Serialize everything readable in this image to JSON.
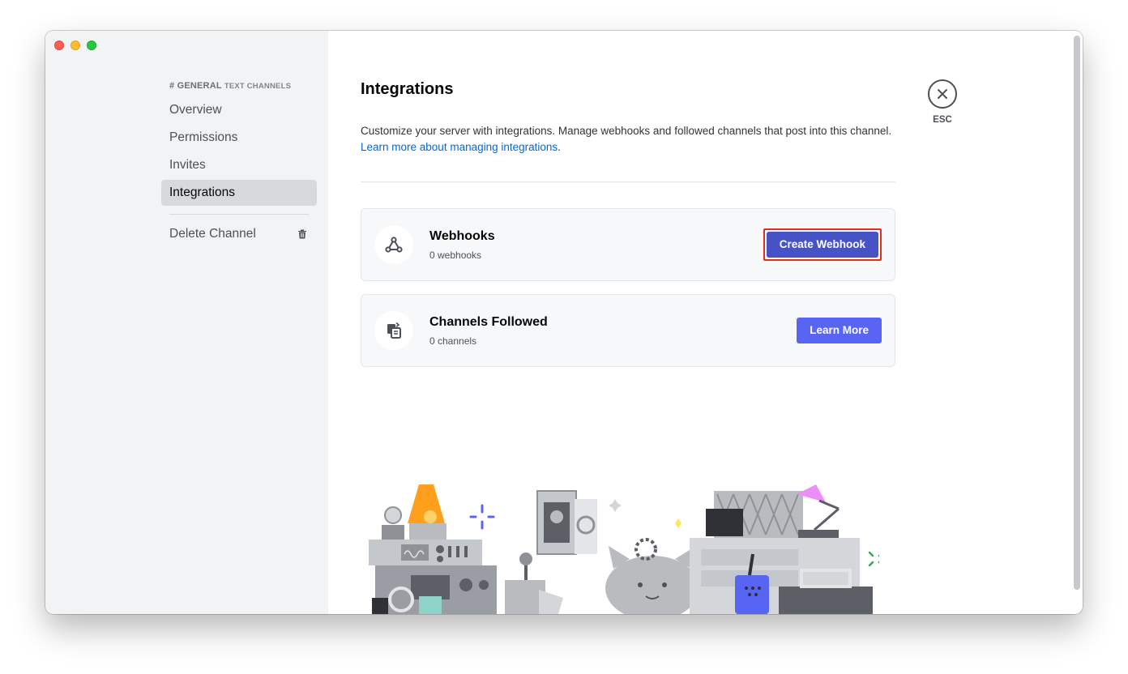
{
  "sidebar": {
    "channel_name": "# general",
    "section_label": "text channels",
    "items": [
      {
        "label": "Overview"
      },
      {
        "label": "Permissions"
      },
      {
        "label": "Invites"
      },
      {
        "label": "Integrations"
      }
    ],
    "delete_label": "Delete Channel"
  },
  "main": {
    "title": "Integrations",
    "description": "Customize your server with integrations. Manage webhooks and followed channels that post into this channel.",
    "learn_link": "Learn more about managing integrations",
    "learn_suffix": ".",
    "cards": [
      {
        "title": "Webhooks",
        "subtitle": "0 webhooks",
        "button": "Create Webhook",
        "icon": "webhook-icon"
      },
      {
        "title": "Channels Followed",
        "subtitle": "0 channels",
        "button": "Learn More",
        "icon": "channel-follow-icon"
      }
    ]
  },
  "close": {
    "label": "ESC"
  },
  "colors": {
    "accent": "#5865f2",
    "highlight_border": "#e22d1d",
    "link": "#0068e0"
  }
}
